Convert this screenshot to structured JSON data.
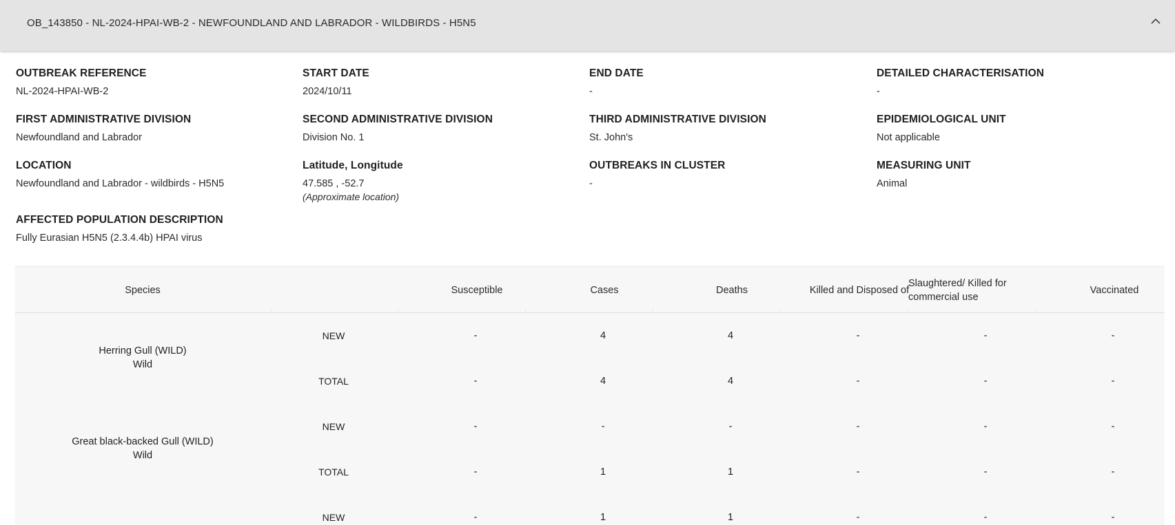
{
  "header": {
    "title": "OB_143850 - NL-2024-HPAI-WB-2 - NEWFOUNDLAND AND LABRADOR - WILDBIRDS - H5N5"
  },
  "fields": {
    "outbreak_reference": {
      "label": "OUTBREAK REFERENCE",
      "value": "NL-2024-HPAI-WB-2"
    },
    "start_date": {
      "label": "START DATE",
      "value": "2024/10/11"
    },
    "end_date": {
      "label": "END DATE",
      "value": "-"
    },
    "detailed_characterisation": {
      "label": "DETAILED CHARACTERISATION",
      "value": "-"
    },
    "first_admin": {
      "label": "FIRST ADMINISTRATIVE DIVISION",
      "value": "Newfoundland and Labrador"
    },
    "second_admin": {
      "label": "SECOND ADMINISTRATIVE DIVISION",
      "value": "Division No. 1"
    },
    "third_admin": {
      "label": "THIRD ADMINISTRATIVE DIVISION",
      "value": "St. John's"
    },
    "epi_unit": {
      "label": "EPIDEMIOLOGICAL UNIT",
      "value": "Not applicable"
    },
    "location": {
      "label": "LOCATION",
      "value": "Newfoundland and Labrador - wildbirds - H5N5"
    },
    "lat_long": {
      "label": "Latitude, Longitude",
      "value": "47.585 , -52.7",
      "note": "(Approximate location)"
    },
    "outbreaks_in_cluster": {
      "label": "OUTBREAKS IN CLUSTER",
      "value": "-"
    },
    "measuring_unit": {
      "label": "MEASURING UNIT",
      "value": "Animal"
    },
    "affected_population": {
      "label": "AFFECTED POPULATION DESCRIPTION",
      "value": "Fully Eurasian H5N5 (2.3.4.4b) HPAI virus"
    }
  },
  "table": {
    "headers": {
      "species": "Species",
      "susceptible": "Susceptible",
      "cases": "Cases",
      "deaths": "Deaths",
      "killed": "Killed and Disposed of",
      "slaughtered": "Slaughtered/ Killed for commercial use",
      "vaccinated": "Vaccinated"
    },
    "species": [
      {
        "name": "Herring Gull (WILD)",
        "category": "Wild",
        "rows": [
          {
            "type": "NEW",
            "susceptible": "-",
            "cases": "4",
            "deaths": "4",
            "killed": "-",
            "slaughtered": "-",
            "vaccinated": "-"
          },
          {
            "type": "TOTAL",
            "susceptible": "-",
            "cases": "4",
            "deaths": "4",
            "killed": "-",
            "slaughtered": "-",
            "vaccinated": "-"
          }
        ]
      },
      {
        "name": "Great black-backed Gull (WILD)",
        "category": "Wild",
        "rows": [
          {
            "type": "NEW",
            "susceptible": "-",
            "cases": "-",
            "deaths": "-",
            "killed": "-",
            "slaughtered": "-",
            "vaccinated": "-"
          },
          {
            "type": "TOTAL",
            "susceptible": "-",
            "cases": "1",
            "deaths": "1",
            "killed": "-",
            "slaughtered": "-",
            "vaccinated": "-"
          }
        ]
      },
      {
        "name": "",
        "category": "",
        "rows": [
          {
            "type": "NEW",
            "susceptible": "-",
            "cases": "1",
            "deaths": "1",
            "killed": "-",
            "slaughtered": "-",
            "vaccinated": "-"
          }
        ]
      }
    ]
  }
}
